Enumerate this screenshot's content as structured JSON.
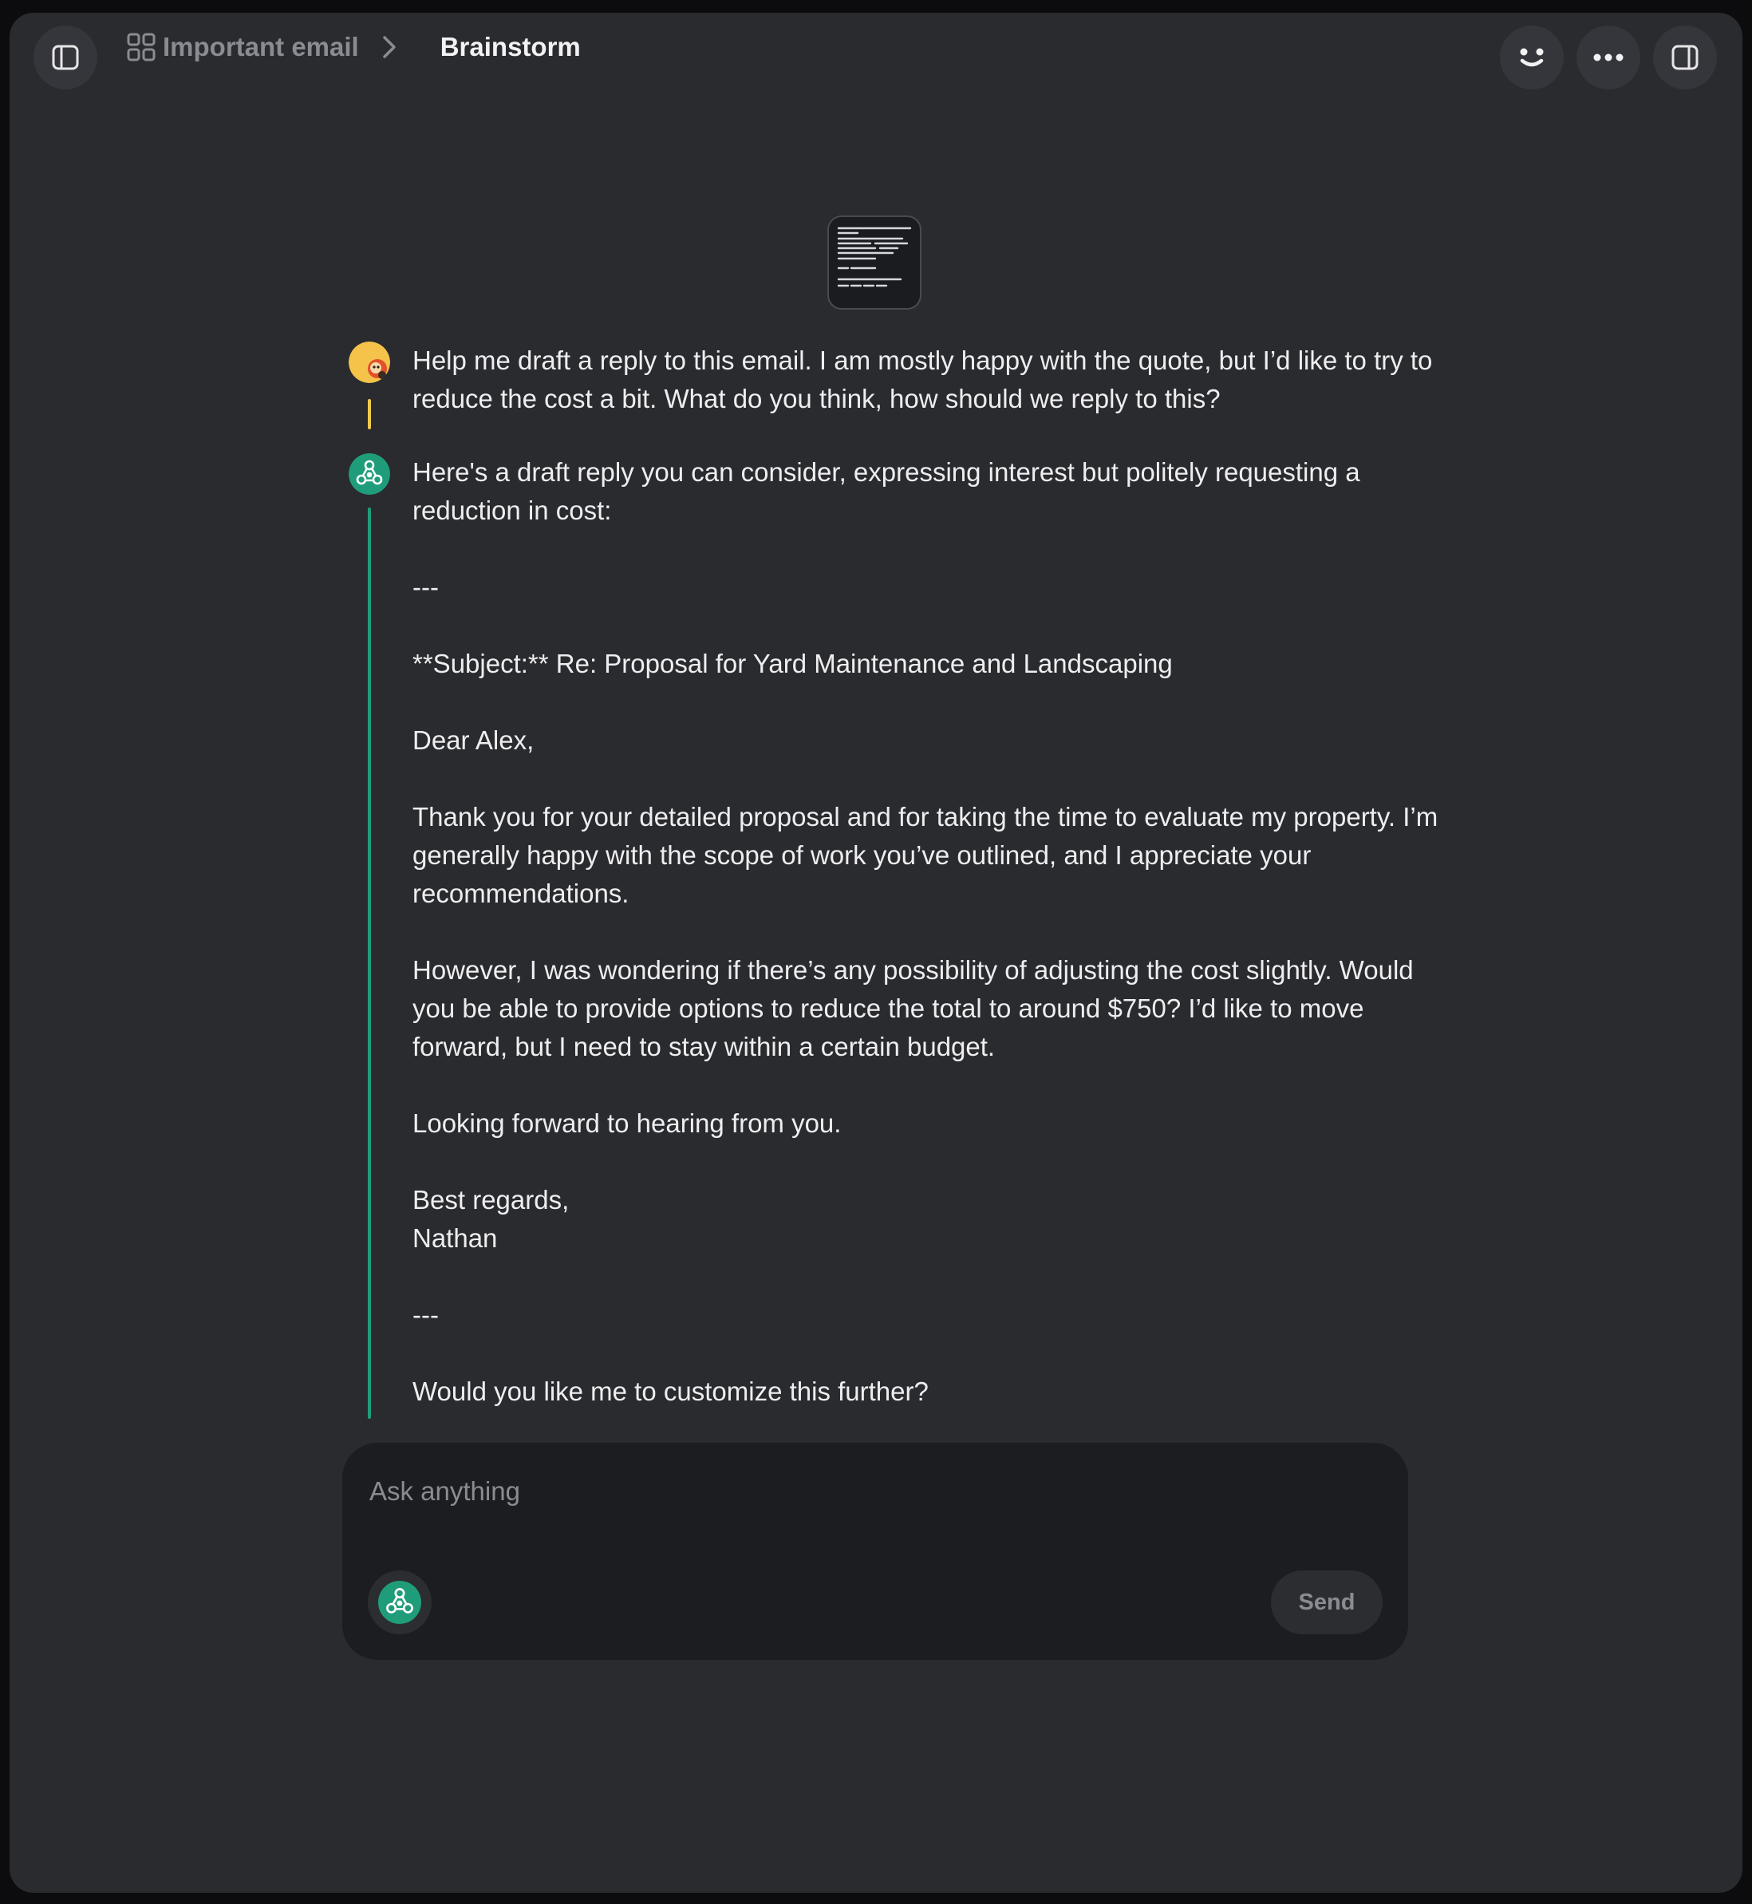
{
  "header": {
    "breadcrumb_parent": "Important email",
    "breadcrumb_current": "Brainstorm"
  },
  "icons": {
    "sidebar_toggle": "sidebar-left-icon",
    "breadcrumb_parent": "grid-icon",
    "breadcrumb_separator": "chevron-right-icon",
    "persona": "smiley-face-icon",
    "more": "more-horizontal-icon",
    "right_panel": "sidebar-right-icon",
    "document": "document-icon",
    "assistant": "assistant-logo-icon"
  },
  "messages": [
    {
      "role": "user",
      "text": "Help me draft a reply to this email. I am mostly happy with the quote, but I’d like to try to reduce the cost a bit. What do you think, how should we reply to this?"
    },
    {
      "role": "assistant",
      "text": "Here's a draft reply you can consider, expressing interest but politely requesting a reduction in cost:\n\n---\n\n**Subject:** Re: Proposal for Yard Maintenance and Landscaping\n\nDear Alex,\n\nThank you for your detailed proposal and for taking the time to evaluate my property. I’m generally happy with the scope of work you’ve outlined, and I appreciate your recommendations.\n\nHowever, I was wondering if there’s any possibility of adjusting the cost slightly. Would you be able to provide options to reduce the total to around $750? I’d like to move forward, but I need to stay within a certain budget.\n\nLooking forward to hearing from you.\n\nBest regards,\nNathan\n\n---\n\nWould you like me to customize this further?"
    }
  ],
  "composer": {
    "placeholder": "Ask anything",
    "value": "",
    "send_label": "Send"
  },
  "colors": {
    "window_bg": "#2a2b2f",
    "user_rail": "#f2c94c",
    "assistant_rail": "#1f9d7a",
    "assistant_avatar": "#1f9d7a",
    "text": "#eeeef0",
    "muted": "#8b8c93"
  }
}
